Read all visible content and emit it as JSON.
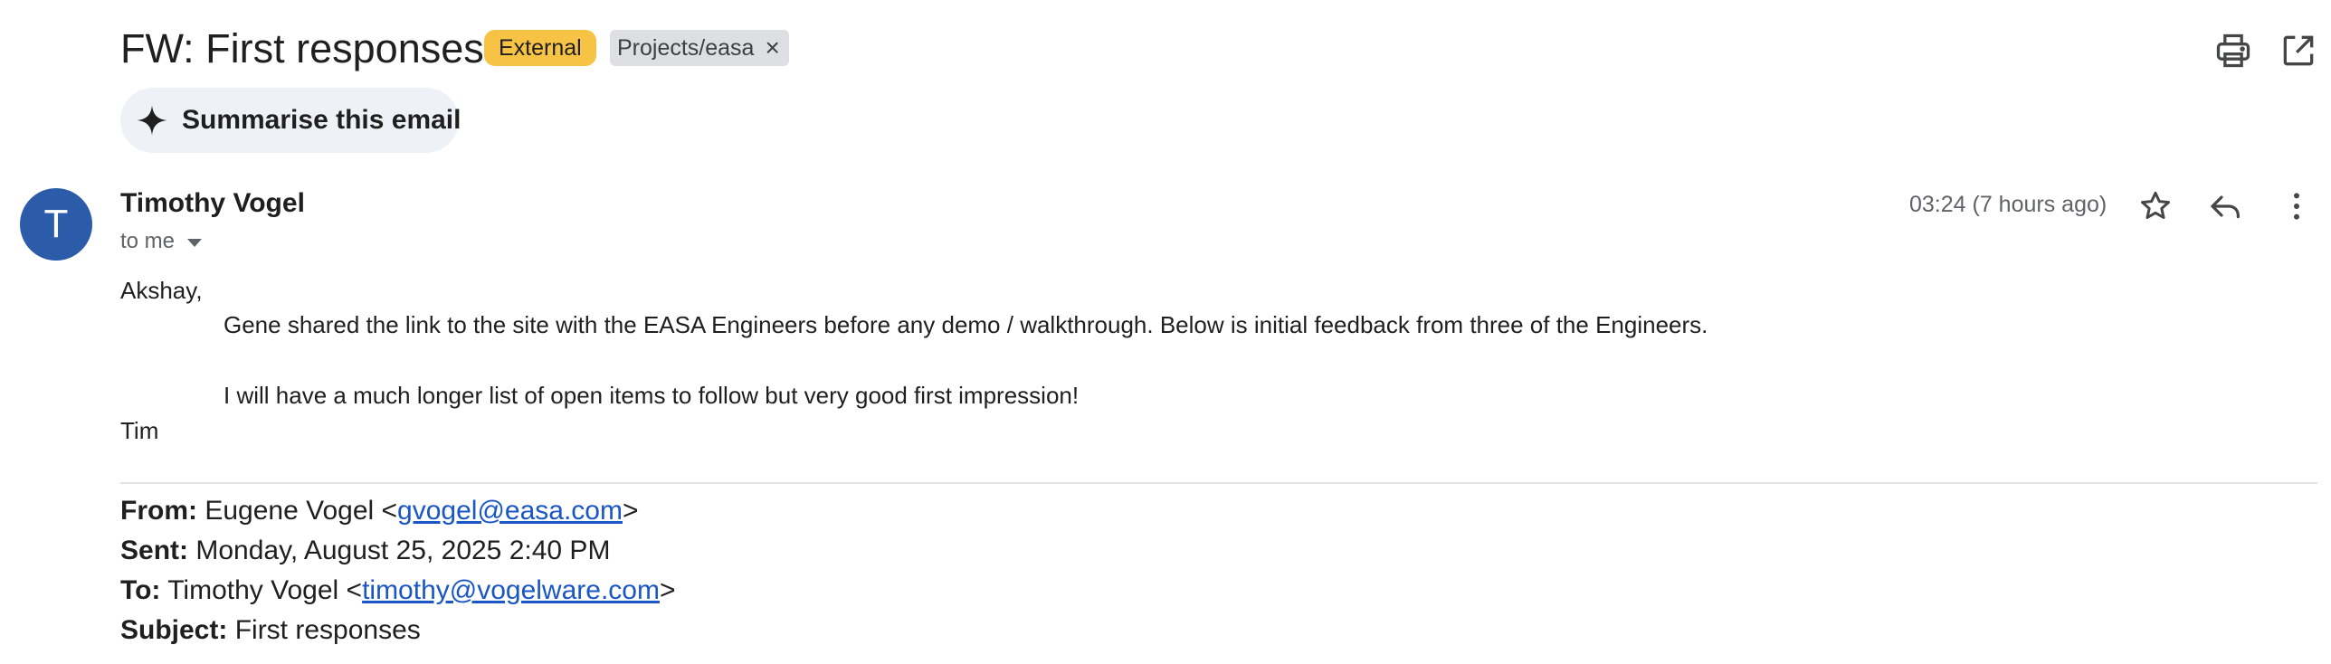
{
  "email": {
    "subject": "FW: First responses",
    "labels": [
      {
        "text": "External",
        "color": "#f6c344"
      },
      {
        "text": "Projects/easa",
        "remove_symbol": "×"
      }
    ],
    "summarise_label": "Summarise this email",
    "sender": {
      "name": "Timothy Vogel",
      "avatar_letter": "T",
      "avatar_color": "#2b5ba9",
      "recipient_summary": "to me"
    },
    "timestamp": "03:24 (7 hours ago)",
    "body": {
      "greeting": "Akshay,",
      "line1": "Gene shared the link to the site with the EASA Engineers before any demo / walkthrough.  Below is initial feedback from three of the Engineers.",
      "line2": "I will have a much longer list of open items to follow but very good first impression!",
      "signoff": "Tim"
    },
    "forwarded": {
      "from_label": "From:",
      "from_name": "Eugene Vogel <",
      "from_email": "gvogel@easa.com",
      "from_close": ">",
      "sent_label": "Sent:",
      "sent_value": "Monday, August 25, 2025 2:40 PM",
      "to_label": "To:",
      "to_name": "Timothy Vogel <",
      "to_email": "timothy@vogelware.com",
      "to_close": ">",
      "subject_label": "Subject:",
      "subject_value": "First responses"
    }
  },
  "icons": {
    "print": "print-icon",
    "popout": "open-in-new-window-icon",
    "summarise": "sparkle-icon",
    "star": "star-icon",
    "reply": "reply-icon",
    "more": "more-vertical-icon",
    "caret": "caret-down-icon"
  },
  "colors": {
    "link": "#1a56c4",
    "secondary_text": "#5f6368",
    "summarise_bg": "#eef2f7",
    "label_gray_bg": "#dddfe2"
  }
}
